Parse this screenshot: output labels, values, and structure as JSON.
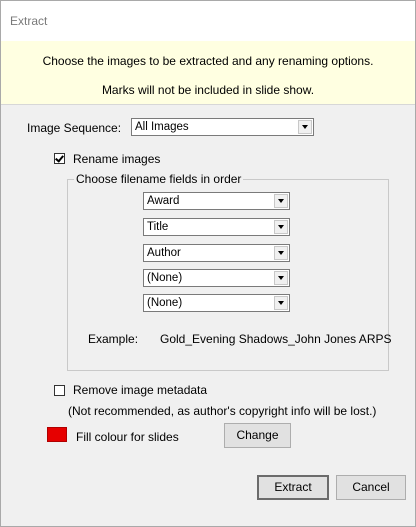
{
  "window": {
    "title": "Extract"
  },
  "banner": {
    "line1": "Choose the images to be extracted and any renaming options.",
    "line2": "Marks will not be included in slide show."
  },
  "image_sequence": {
    "label": "Image Sequence:",
    "value": "All Images"
  },
  "rename": {
    "label": "Rename images",
    "checked": true,
    "group_label": "Choose filename fields in order",
    "fields": [
      "Award",
      "Title",
      "Author",
      "(None)",
      "(None)"
    ],
    "example_label": "Example:",
    "example_value": "Gold_Evening Shadows_John Jones ARPS"
  },
  "metadata": {
    "label": "Remove image metadata",
    "checked": false,
    "note": "(Not recommended, as author's copyright info will be lost.)"
  },
  "fill": {
    "label": "Fill colour for slides",
    "color": "#e60000",
    "change_label": "Change"
  },
  "actions": {
    "extract_label": "Extract",
    "cancel_label": "Cancel"
  }
}
